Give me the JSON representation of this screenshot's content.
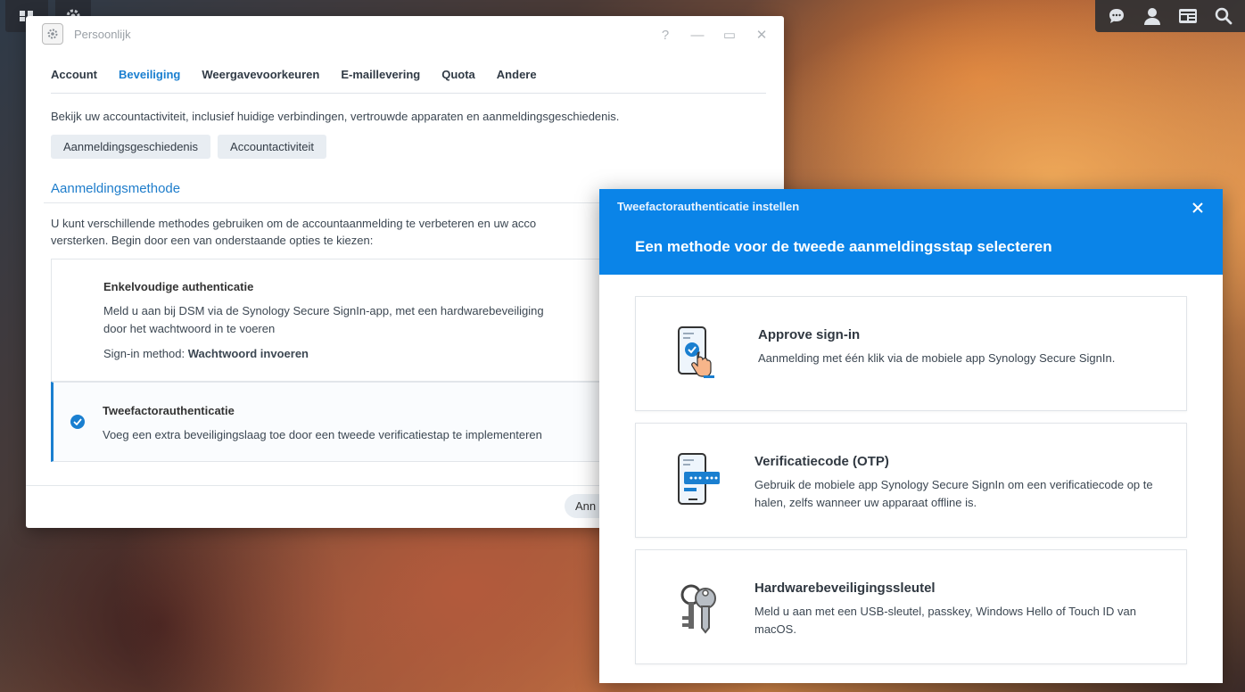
{
  "window": {
    "title": "Persoonlijk",
    "controls": {
      "help": "?",
      "minimize": "—",
      "maximize": "▭",
      "close": "✕"
    },
    "tabs": [
      {
        "label": "Account",
        "active": false
      },
      {
        "label": "Beveiliging",
        "active": true
      },
      {
        "label": "Weergavevoorkeuren",
        "active": false
      },
      {
        "label": "E-maillevering",
        "active": false
      },
      {
        "label": "Quota",
        "active": false
      },
      {
        "label": "Andere",
        "active": false
      }
    ],
    "description": "Bekijk uw accountactiviteit, inclusief huidige verbindingen, vertrouwde apparaten en aanmeldingsgeschiedenis.",
    "buttons": {
      "history": "Aanmeldingsgeschiedenis",
      "activity": "Accountactiviteit"
    },
    "section_title": "Aanmeldingsmethode",
    "section_text_1": "U kunt verschillende methodes gebruiken om de accountaanmelding te verbeteren en uw acco",
    "section_text_2": "versterken. Begin door een van onderstaande opties te kiezen:",
    "option_single": {
      "title": "Enkelvoudige authenticatie",
      "text_1": "Meld u aan bij DSM via de Synology Secure SignIn-app, met een hardwarebeveiliging",
      "text_2": "door het wachtwoord in te voeren",
      "method_label": "Sign-in method:",
      "method_value": "Wachtwoord invoeren"
    },
    "option_two_factor": {
      "title": "Tweefactorauthenticatie",
      "text": "Voeg een extra beveiligingslaag toe door een tweede verificatiestap te implementeren"
    },
    "footer_button_partial": "Ann"
  },
  "dialog": {
    "window_title": "Tweefactorauthenticatie instellen",
    "heading": "Een methode voor de tweede aanmeldingsstap selecteren",
    "methods": [
      {
        "title": "Approve sign-in",
        "text": "Aanmelding met één klik via de mobiele app Synology Secure SignIn.",
        "icon": "phone-tap-icon"
      },
      {
        "title": "Verificatiecode (OTP)",
        "text": "Gebruik de mobiele app Synology Secure SignIn om een verificatiecode op te halen, zelfs wanneer uw apparaat offline is.",
        "icon": "phone-code-icon"
      },
      {
        "title": "Hardwarebeveiligingssleutel",
        "text": "Meld u aan met een USB-sleutel, passkey, Windows Hello of Touch ID van macOS.",
        "icon": "keys-icon"
      }
    ]
  },
  "colors": {
    "accent": "#1a7fd0",
    "dialog_header": "#0a84e8"
  }
}
